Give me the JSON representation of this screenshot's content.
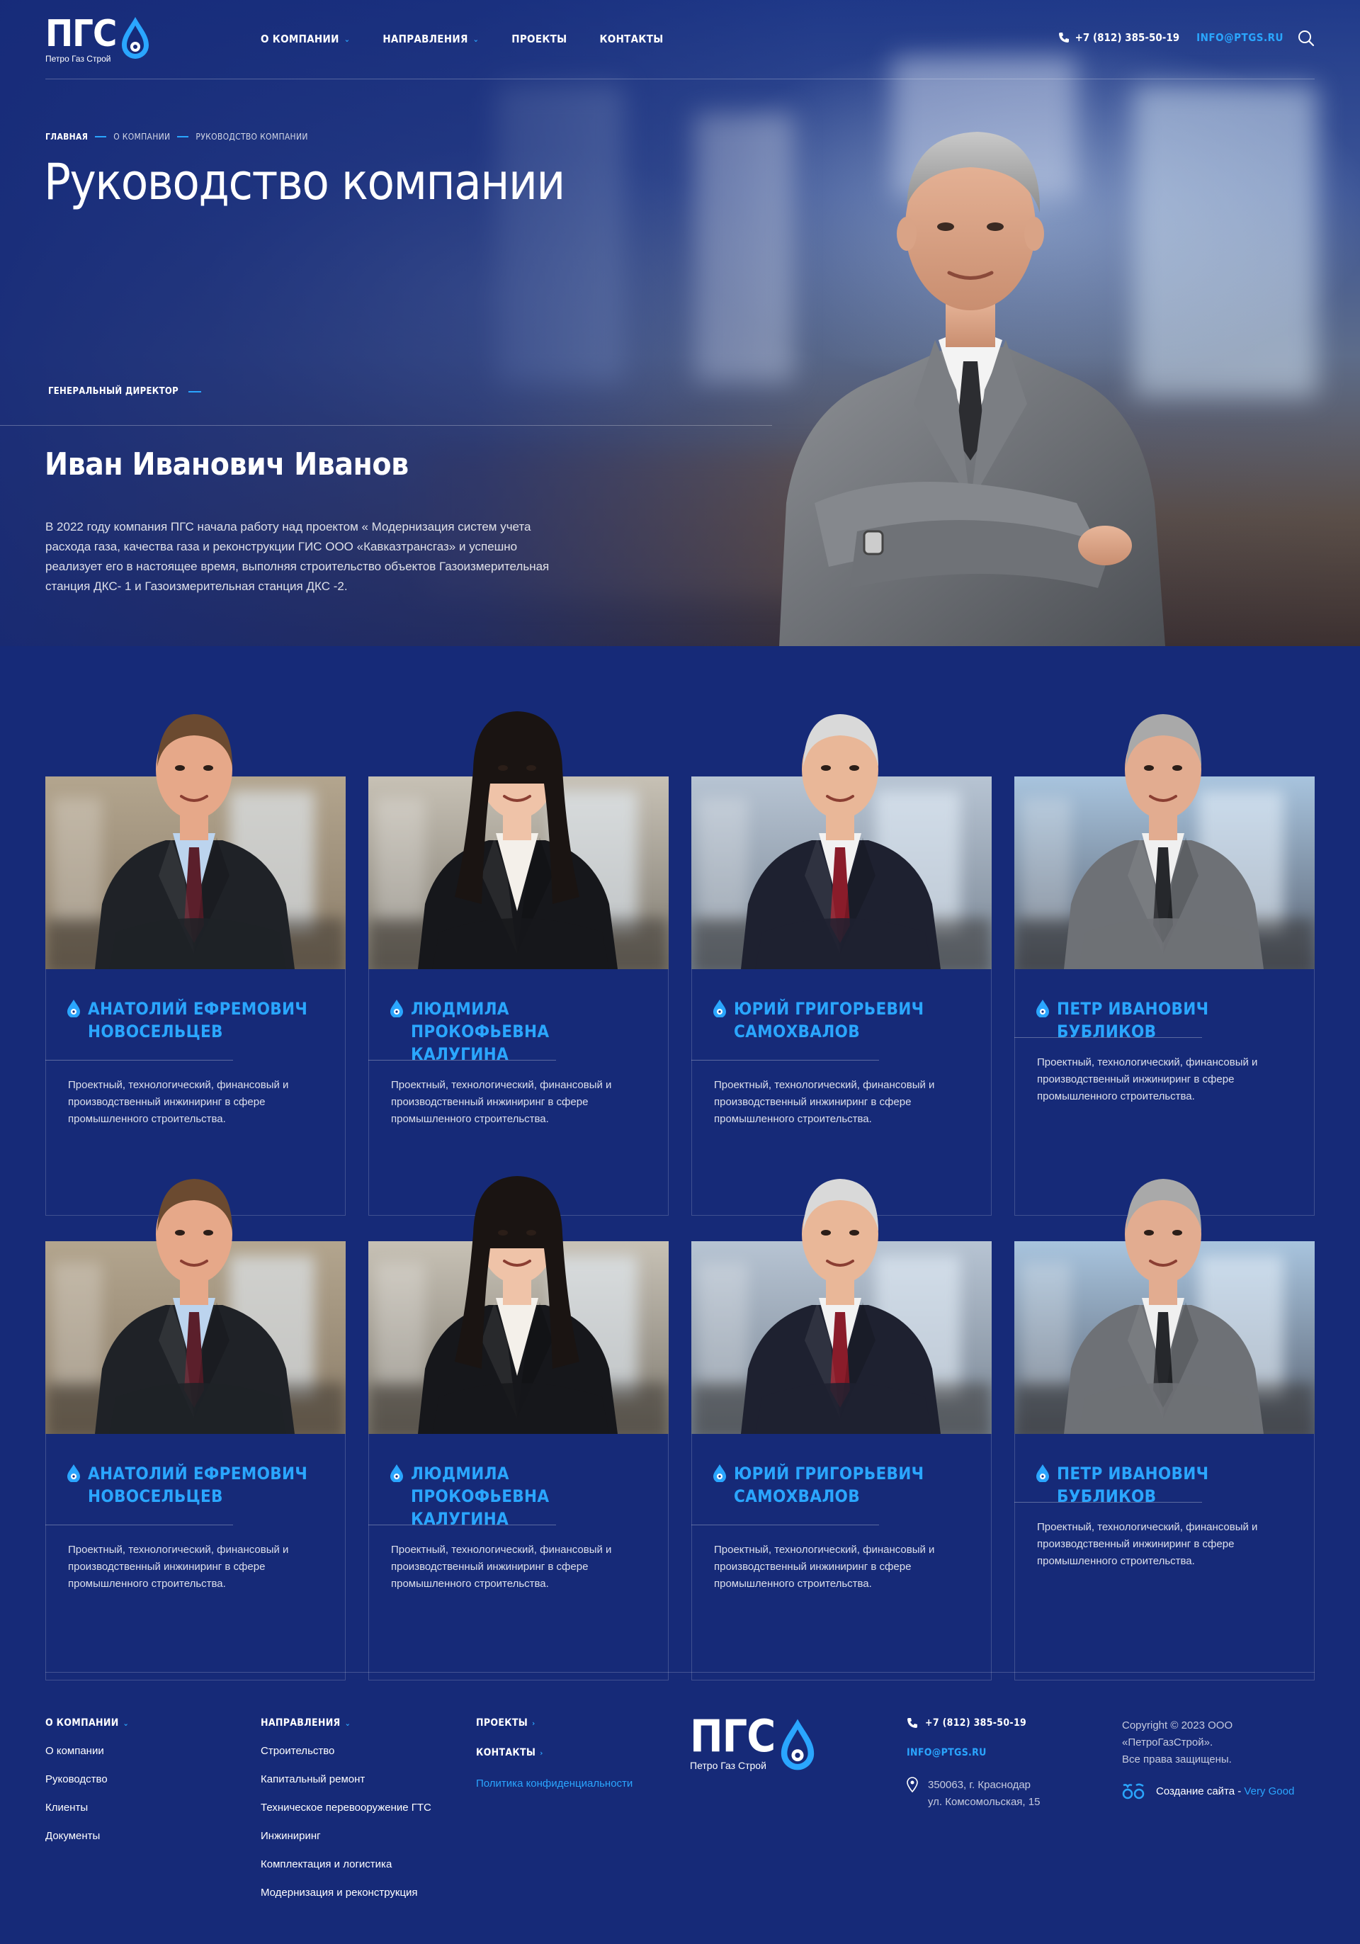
{
  "brand": {
    "logo_text": "ПГС",
    "logo_subtitle": "Петро Газ Строй",
    "accent": "#2aa6ff",
    "background": "#162a78"
  },
  "nav": {
    "items": [
      {
        "label": "О КОМПАНИИ",
        "has_dropdown": true
      },
      {
        "label": "НАПРАВЛЕНИЯ",
        "has_dropdown": true
      },
      {
        "label": "ПРОЕКТЫ",
        "has_dropdown": false
      },
      {
        "label": "КОНТАКТЫ",
        "has_dropdown": false
      }
    ],
    "phone": "+7 (812) 385-50-19",
    "email": "INFO@PTGS.RU",
    "search_icon": "search-icon"
  },
  "breadcrumb": [
    "ГЛАВНАЯ",
    "О КОМПАНИИ",
    "РУКОВОДСТВО КОМПАНИИ"
  ],
  "page_title": "Руководство компании",
  "director": {
    "role": "ГЕНЕРАЛЬНЫЙ ДИРЕКТОР",
    "name": "Иван Иванович Иванов",
    "text": "В 2022 году компания ПГС начала работу над проектом « Модернизация систем учета расхода газа, качества газа и реконструкции ГИС ООО «Кавказтрансгаз» и успешно реализует его в настоящее время, выполняя строительство объектов Газоизмерительная станция ДКС- 1 и Газоизмерительная станция ДКС -2."
  },
  "team": [
    {
      "name": "Анатолий Ефремович Новосельцев",
      "desc": "Проектный, технологический, финансовый и производственный инжиниринг в сфере промышленного строительства."
    },
    {
      "name": "Людмила Прокофьевна Калугина",
      "desc": "Проектный, технологический, финансовый и производственный инжиниринг в сфере промышленного строительства."
    },
    {
      "name": "Юрий Григорьевич Самохвалов",
      "desc": "Проектный, технологический, финансовый и производственный инжиниринг в сфере промышленного строительства."
    },
    {
      "name": "Петр Иванович Бубликов",
      "desc": "Проектный, технологический, финансовый и производственный инжиниринг в сфере промышленного строительства."
    },
    {
      "name": "Анатолий Ефремович Новосельцев",
      "desc": "Проектный, технологический, финансовый и производственный инжиниринг в сфере промышленного строительства."
    },
    {
      "name": "Людмила Прокофьевна Калугина",
      "desc": "Проектный, технологический, финансовый и производственный инжиниринг в сфере промышленного строительства."
    },
    {
      "name": "Юрий Григорьевич Самохвалов",
      "desc": "Проектный, технологический, финансовый и производственный инжиниринг в сфере промышленного строительства."
    },
    {
      "name": "Петр Иванович Бубликов",
      "desc": "Проектный, технологический, финансовый и производственный инжиниринг в сфере промышленного строительства."
    }
  ],
  "footer": {
    "col1": {
      "head": "О КОМПАНИИ",
      "links": [
        "О компании",
        "Руководство",
        "Клиенты",
        "Документы"
      ]
    },
    "col2": {
      "head": "НАПРАВЛЕНИЯ",
      "links": [
        "Строительство",
        "Капитальный ремонт",
        "Техническое перевооружение ГТС",
        "Инжиниринг",
        "Комплектация и логистика",
        "Модернизация и реконструкция"
      ]
    },
    "col3": {
      "projects": "ПРОЕКТЫ",
      "contacts": "КОНТАКТЫ",
      "privacy": "Политика конфиденциальности"
    },
    "phone": "+7 (812) 385-50-19",
    "email": "INFO@PTGS.RU",
    "address_line1": "350063, г. Краснодар",
    "address_line2": "ул. Комсомольская, 15",
    "copyright_line1": "Copyright © 2023 ООО",
    "copyright_line2": "«ПетроГазСтрой».",
    "copyright_line3": "Все права защищены.",
    "made_by_prefix": "Создание сайта - ",
    "made_by_link": "Very Good"
  }
}
